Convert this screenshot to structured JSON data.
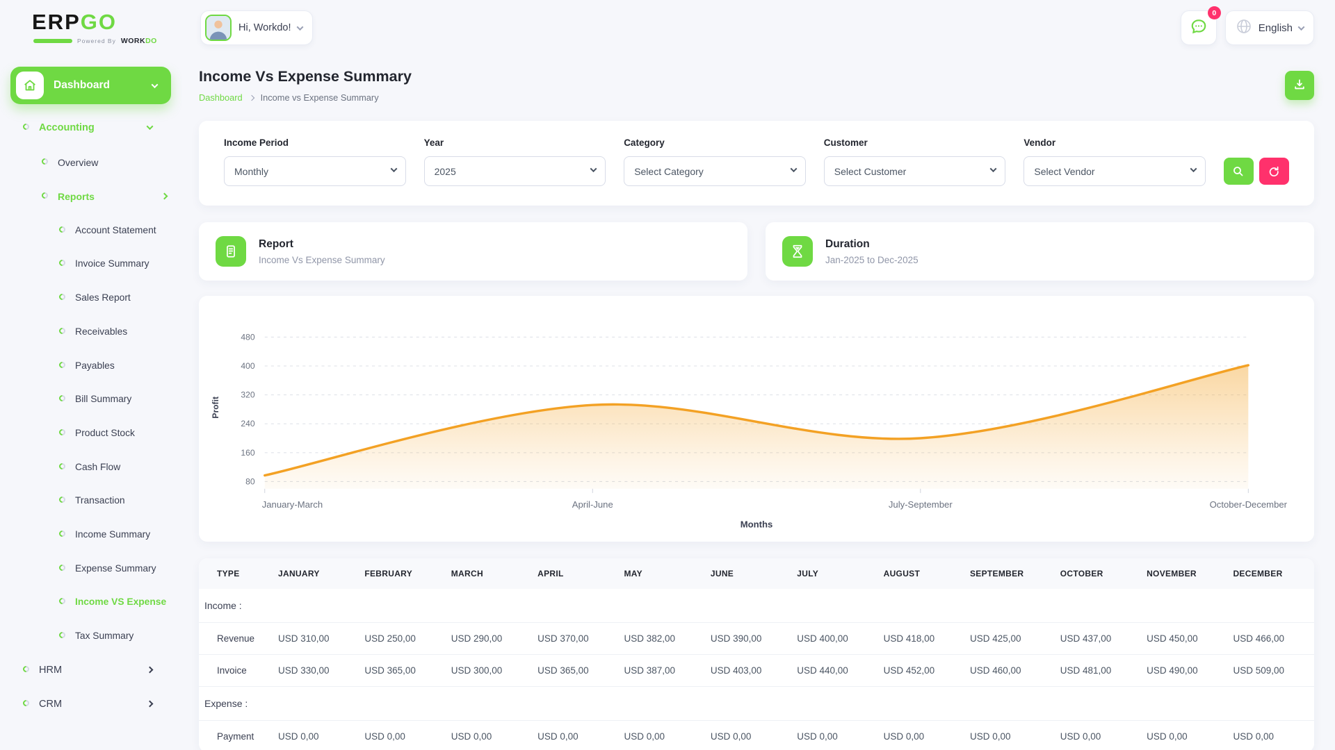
{
  "header": {
    "logo": {
      "erp": "ERP",
      "go": "GO",
      "powered_by": "Powered By",
      "brand_work": "WORK",
      "brand_do": "DO"
    },
    "user": {
      "greeting": "Hi, Workdo!"
    },
    "notification": {
      "count": "0"
    },
    "language": {
      "label": "English"
    }
  },
  "sidebar": {
    "dashboard_label": "Dashboard",
    "items": [
      {
        "label": "Accounting",
        "level": 1,
        "active": true,
        "chevron": "down"
      },
      {
        "label": "Overview",
        "level": 2
      },
      {
        "label": "Reports",
        "level": 2,
        "active": true,
        "chevron": "right"
      },
      {
        "label": "Account Statement",
        "level": 3
      },
      {
        "label": "Invoice Summary",
        "level": 3
      },
      {
        "label": "Sales Report",
        "level": 3
      },
      {
        "label": "Receivables",
        "level": 3
      },
      {
        "label": "Payables",
        "level": 3
      },
      {
        "label": "Bill Summary",
        "level": 3
      },
      {
        "label": "Product Stock",
        "level": 3
      },
      {
        "label": "Cash Flow",
        "level": 3
      },
      {
        "label": "Transaction",
        "level": 3
      },
      {
        "label": "Income Summary",
        "level": 3
      },
      {
        "label": "Expense Summary",
        "level": 3
      },
      {
        "label": "Income VS Expense",
        "level": 3,
        "active": true
      },
      {
        "label": "Tax Summary",
        "level": 3
      },
      {
        "label": "HRM",
        "level": 1,
        "chevron": "right"
      },
      {
        "label": "CRM",
        "level": 1,
        "chevron": "right"
      }
    ]
  },
  "page": {
    "title": "Income Vs Expense Summary",
    "breadcrumb": [
      "Dashboard",
      "Income vs Expense Summary"
    ]
  },
  "filters": {
    "fields": [
      {
        "label": "Income Period",
        "value": "Monthly"
      },
      {
        "label": "Year",
        "value": "2025"
      },
      {
        "label": "Category",
        "value": "Select Category"
      },
      {
        "label": "Customer",
        "value": "Select Customer"
      },
      {
        "label": "Vendor",
        "value": "Select Vendor"
      }
    ]
  },
  "cards": {
    "report": {
      "title": "Report",
      "subtitle": "Income Vs Expense Summary"
    },
    "duration": {
      "title": "Duration",
      "subtitle": "Jan-2025 to Dec-2025"
    }
  },
  "chart_data": {
    "type": "area",
    "categories": [
      "January-March",
      "April-June",
      "July-September",
      "October-December"
    ],
    "series": [
      {
        "name": "Profit",
        "values": [
          97,
          292,
          200,
          402
        ]
      }
    ],
    "title": "",
    "xlabel": "Months",
    "ylabel": "Profit",
    "yticks": [
      80,
      160,
      240,
      320,
      400,
      480
    ],
    "ylim": [
      60,
      510
    ],
    "line_color": "#f3a124",
    "grid": "horizontal-dashed",
    "legend_position": "none"
  },
  "table": {
    "columns": [
      "TYPE",
      "JANUARY",
      "FEBRUARY",
      "MARCH",
      "APRIL",
      "MAY",
      "JUNE",
      "JULY",
      "AUGUST",
      "SEPTEMBER",
      "OCTOBER",
      "NOVEMBER",
      "DECEMBER"
    ],
    "sections": [
      {
        "label": "Income :",
        "rows": [
          {
            "type": "Revenue",
            "values": [
              "USD 310,00",
              "USD 250,00",
              "USD 290,00",
              "USD 370,00",
              "USD 382,00",
              "USD 390,00",
              "USD 400,00",
              "USD 418,00",
              "USD 425,00",
              "USD 437,00",
              "USD 450,00",
              "USD 466,00"
            ]
          },
          {
            "type": "Invoice",
            "values": [
              "USD 330,00",
              "USD 365,00",
              "USD 300,00",
              "USD 365,00",
              "USD 387,00",
              "USD 403,00",
              "USD 440,00",
              "USD 452,00",
              "USD 460,00",
              "USD 481,00",
              "USD 490,00",
              "USD 509,00"
            ]
          }
        ]
      },
      {
        "label": "Expense :",
        "rows": [
          {
            "type": "Payment",
            "values": [
              "USD 0,00",
              "USD 0,00",
              "USD 0,00",
              "USD 0,00",
              "USD 0,00",
              "USD 0,00",
              "USD 0,00",
              "USD 0,00",
              "USD 0,00",
              "USD 0,00",
              "USD 0,00",
              "USD 0,00"
            ]
          }
        ]
      }
    ]
  },
  "colors": {
    "primary_green": "#6fd943",
    "pink": "#ff316c",
    "chart_orange": "#f3a124"
  }
}
